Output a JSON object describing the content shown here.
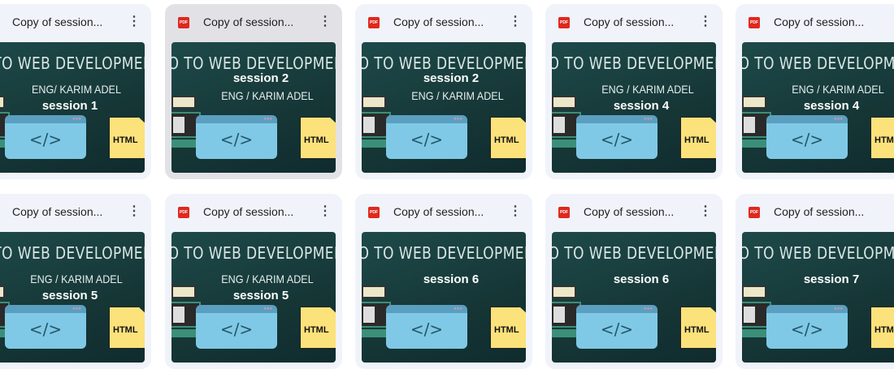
{
  "thumb_title": "INTRO TO WEB DEVELOPMENT",
  "html_label": "HTML",
  "code_glyph": "</>",
  "file_type": "PDF",
  "more_glyph": "⋮",
  "rows": [
    [
      {
        "name": "Copy of session...",
        "eng": "ENG/ KARIM ADEL",
        "session": "session 1",
        "order": "eng-first"
      },
      {
        "name": "Copy of session...",
        "eng": "ENG / KARIM ADEL",
        "session": "session 2",
        "order": "session-first",
        "hover": true
      },
      {
        "name": "Copy of session...",
        "eng": "ENG / KARIM ADEL",
        "session": "session 2",
        "order": "session-first"
      },
      {
        "name": "Copy of session...",
        "eng": "ENG / KARIM ADEL",
        "session": "session 4",
        "order": "eng-first"
      },
      {
        "name": "Copy of session...",
        "eng": "ENG / KARIM ADEL",
        "session": "session 4",
        "order": "eng-first"
      }
    ],
    [
      {
        "name": "Copy of session...",
        "eng": "ENG / KARIM ADEL",
        "session": "session 5",
        "order": "eng-first"
      },
      {
        "name": "Copy of session...",
        "eng": "ENG / KARIM ADEL",
        "session": "session 5",
        "order": "eng-first"
      },
      {
        "name": "Copy of session...",
        "eng": null,
        "session": "session 6",
        "order": "session-only"
      },
      {
        "name": "Copy of session...",
        "eng": null,
        "session": "session 6",
        "order": "session-only"
      },
      {
        "name": "Copy of session...",
        "eng": null,
        "session": "session 7",
        "order": "session-only"
      }
    ]
  ]
}
